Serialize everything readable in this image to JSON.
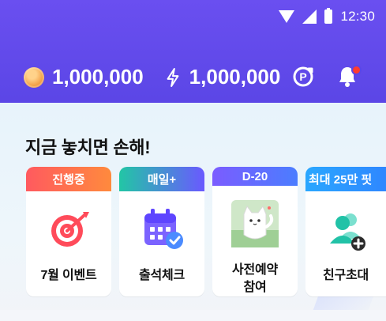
{
  "status_bar": {
    "time": "12:30"
  },
  "header": {
    "coin_balance": "1,000,000",
    "energy_balance": "1,000,000",
    "icons": {
      "coin": "coin-icon",
      "energy": "lightning-icon",
      "points_refresh": "points-refresh-icon",
      "notifications": "bell-icon"
    }
  },
  "section": {
    "title": "지금 놓치면 손해!",
    "cards": [
      {
        "tag": "진행중",
        "label": "7월 이벤트",
        "icon": "target-icon"
      },
      {
        "tag": "매일+",
        "label": "출석체크",
        "icon": "calendar-check-icon"
      },
      {
        "tag": "D-20",
        "label_line1": "사전예약",
        "label_line2": "참여",
        "icon": "cat-photo-icon"
      },
      {
        "tag": "최대 25만 핏",
        "label": "친구초대",
        "icon": "add-friend-icon"
      }
    ]
  }
}
